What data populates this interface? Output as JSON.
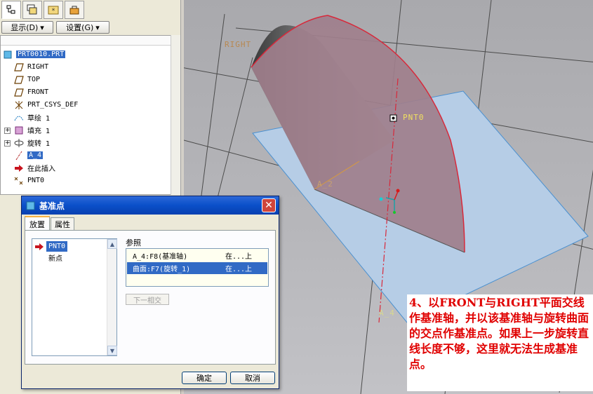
{
  "toolbar": {
    "display_menu": "显示(D)",
    "settings_menu": "设置(G)"
  },
  "model_tree": {
    "root": "PRT0010.PRT",
    "items": [
      {
        "label": "RIGHT",
        "icon": "datum-plane-icon"
      },
      {
        "label": "TOP",
        "icon": "datum-plane-icon"
      },
      {
        "label": "FRONT",
        "icon": "datum-plane-icon"
      },
      {
        "label": "PRT_CSYS_DEF",
        "icon": "csys-icon"
      },
      {
        "label": "草绘 1",
        "icon": "sketch-icon"
      },
      {
        "label": "填充 1",
        "icon": "fill-icon"
      },
      {
        "label": "旋转 1",
        "icon": "revolve-icon"
      },
      {
        "label": "A_4",
        "icon": "datum-axis-icon"
      },
      {
        "label": "在此插入",
        "icon": "insert-here-arrow-icon"
      },
      {
        "label": "PNT0",
        "icon": "datum-point-icon"
      }
    ]
  },
  "viewport": {
    "labels": {
      "right_plane": "RIGHT",
      "point": "PNT0",
      "axis_mid": "A_2",
      "axis_bottom": "A_4"
    },
    "colors": {
      "plane_fill": "#b6cde6",
      "surface_fill": "#9f7f8c",
      "edge_red": "#d8283a",
      "label_yellow": "#f0e060"
    }
  },
  "dialog": {
    "title": "基准点",
    "close": "✕",
    "tabs": [
      "放置",
      "属性"
    ],
    "points": [
      "PNT0",
      "新点"
    ],
    "references_label": "参照",
    "references": [
      {
        "ref": "A_4:F8(基准轴)",
        "constraint": "在...上"
      },
      {
        "ref": "曲面:F7(旋转_1)",
        "constraint": "在...上"
      }
    ],
    "next_intersection": "下一相交",
    "ok": "确定",
    "cancel": "取消"
  },
  "annotation": {
    "text": "4、以FRONT与RIGHT平面交线作基准轴，并以该基准轴与旋转曲面的交点作基准点。如果上一步旋转直线长度不够，这里就无法生成基准点。"
  }
}
